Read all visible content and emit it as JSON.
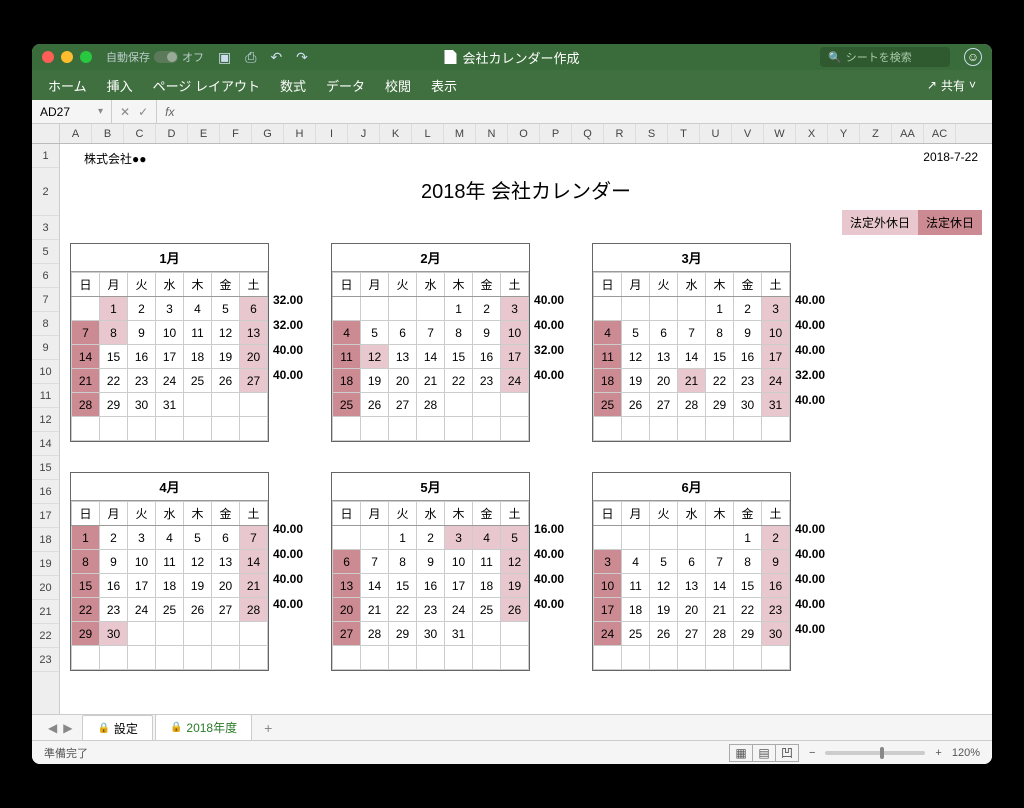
{
  "titlebar": {
    "autosave_label": "自動保存",
    "autosave_state": "オフ",
    "doc_title": "会社カレンダー作成",
    "search_placeholder": "シートを検索"
  },
  "ribbon": {
    "tabs": [
      "ホーム",
      "挿入",
      "ページ レイアウト",
      "数式",
      "データ",
      "校閲",
      "表示"
    ],
    "share_label": "共有"
  },
  "fxbar": {
    "cell_ref": "AD27",
    "fx_label": "fx"
  },
  "col_headers": [
    "A",
    "B",
    "C",
    "D",
    "E",
    "F",
    "G",
    "H",
    "I",
    "J",
    "K",
    "L",
    "M",
    "N",
    "O",
    "P",
    "Q",
    "R",
    "S",
    "T",
    "U",
    "V",
    "W",
    "X",
    "Y",
    "Z",
    "AA",
    "AC"
  ],
  "row_headers": [
    "1",
    "2",
    "3",
    "5",
    "6",
    "7",
    "8",
    "9",
    "10",
    "11",
    "12",
    "14",
    "15",
    "16",
    "17",
    "18",
    "19",
    "20",
    "21",
    "22",
    "23"
  ],
  "sheet": {
    "company": "株式会社●●",
    "date": "2018-7-22",
    "main_title": "2018年 会社カレンダー",
    "legend_light": "法定外休日",
    "legend_dark": "法定休日",
    "dow": [
      "日",
      "月",
      "火",
      "水",
      "木",
      "金",
      "土"
    ],
    "months": [
      {
        "title": "1月",
        "weeks": [
          [
            null,
            [
              1,
              1
            ],
            [
              2,
              0
            ],
            [
              3,
              0
            ],
            [
              4,
              0
            ],
            [
              5,
              0
            ],
            [
              6,
              1
            ]
          ],
          [
            [
              7,
              2
            ],
            [
              8,
              1
            ],
            [
              9,
              0
            ],
            [
              10,
              0
            ],
            [
              11,
              0
            ],
            [
              12,
              0
            ],
            [
              13,
              1
            ]
          ],
          [
            [
              14,
              2
            ],
            [
              15,
              0
            ],
            [
              16,
              0
            ],
            [
              17,
              0
            ],
            [
              18,
              0
            ],
            [
              19,
              0
            ],
            [
              20,
              1
            ]
          ],
          [
            [
              21,
              2
            ],
            [
              22,
              0
            ],
            [
              23,
              0
            ],
            [
              24,
              0
            ],
            [
              25,
              0
            ],
            [
              26,
              0
            ],
            [
              27,
              1
            ]
          ],
          [
            [
              28,
              2
            ],
            [
              29,
              0
            ],
            [
              30,
              0
            ],
            [
              31,
              0
            ],
            null,
            null,
            null
          ],
          [
            null,
            null,
            null,
            null,
            null,
            null,
            null
          ]
        ],
        "hours": [
          "32.00",
          "32.00",
          "40.00",
          "40.00"
        ]
      },
      {
        "title": "2月",
        "weeks": [
          [
            null,
            null,
            null,
            null,
            [
              1,
              0
            ],
            [
              2,
              0
            ],
            [
              3,
              1
            ]
          ],
          [
            [
              4,
              2
            ],
            [
              5,
              0
            ],
            [
              6,
              0
            ],
            [
              7,
              0
            ],
            [
              8,
              0
            ],
            [
              9,
              0
            ],
            [
              10,
              1
            ]
          ],
          [
            [
              11,
              2
            ],
            [
              12,
              1
            ],
            [
              13,
              0
            ],
            [
              14,
              0
            ],
            [
              15,
              0
            ],
            [
              16,
              0
            ],
            [
              17,
              1
            ]
          ],
          [
            [
              18,
              2
            ],
            [
              19,
              0
            ],
            [
              20,
              0
            ],
            [
              21,
              0
            ],
            [
              22,
              0
            ],
            [
              23,
              0
            ],
            [
              24,
              1
            ]
          ],
          [
            [
              25,
              2
            ],
            [
              26,
              0
            ],
            [
              27,
              0
            ],
            [
              28,
              0
            ],
            null,
            null,
            null
          ],
          [
            null,
            null,
            null,
            null,
            null,
            null,
            null
          ]
        ],
        "hours": [
          "40.00",
          "40.00",
          "32.00",
          "40.00"
        ]
      },
      {
        "title": "3月",
        "weeks": [
          [
            null,
            null,
            null,
            null,
            [
              1,
              0
            ],
            [
              2,
              0
            ],
            [
              3,
              1
            ]
          ],
          [
            [
              4,
              2
            ],
            [
              5,
              0
            ],
            [
              6,
              0
            ],
            [
              7,
              0
            ],
            [
              8,
              0
            ],
            [
              9,
              0
            ],
            [
              10,
              1
            ]
          ],
          [
            [
              11,
              2
            ],
            [
              12,
              0
            ],
            [
              13,
              0
            ],
            [
              14,
              0
            ],
            [
              15,
              0
            ],
            [
              16,
              0
            ],
            [
              17,
              1
            ]
          ],
          [
            [
              18,
              2
            ],
            [
              19,
              0
            ],
            [
              20,
              0
            ],
            [
              21,
              1
            ],
            [
              22,
              0
            ],
            [
              23,
              0
            ],
            [
              24,
              1
            ]
          ],
          [
            [
              25,
              2
            ],
            [
              26,
              0
            ],
            [
              27,
              0
            ],
            [
              28,
              0
            ],
            [
              29,
              0
            ],
            [
              30,
              0
            ],
            [
              31,
              1
            ]
          ],
          [
            null,
            null,
            null,
            null,
            null,
            null,
            null
          ]
        ],
        "hours": [
          "40.00",
          "40.00",
          "40.00",
          "32.00",
          "40.00"
        ]
      },
      {
        "title": "4月",
        "weeks": [
          [
            [
              1,
              2
            ],
            [
              2,
              0
            ],
            [
              3,
              0
            ],
            [
              4,
              0
            ],
            [
              5,
              0
            ],
            [
              6,
              0
            ],
            [
              7,
              1
            ]
          ],
          [
            [
              8,
              2
            ],
            [
              9,
              0
            ],
            [
              10,
              0
            ],
            [
              11,
              0
            ],
            [
              12,
              0
            ],
            [
              13,
              0
            ],
            [
              14,
              1
            ]
          ],
          [
            [
              15,
              2
            ],
            [
              16,
              0
            ],
            [
              17,
              0
            ],
            [
              18,
              0
            ],
            [
              19,
              0
            ],
            [
              20,
              0
            ],
            [
              21,
              1
            ]
          ],
          [
            [
              22,
              2
            ],
            [
              23,
              0
            ],
            [
              24,
              0
            ],
            [
              25,
              0
            ],
            [
              26,
              0
            ],
            [
              27,
              0
            ],
            [
              28,
              1
            ]
          ],
          [
            [
              29,
              2
            ],
            [
              30,
              1
            ],
            null,
            null,
            null,
            null,
            null
          ],
          [
            null,
            null,
            null,
            null,
            null,
            null,
            null
          ]
        ],
        "hours": [
          "40.00",
          "40.00",
          "40.00",
          "40.00"
        ]
      },
      {
        "title": "5月",
        "weeks": [
          [
            null,
            null,
            [
              1,
              0
            ],
            [
              2,
              0
            ],
            [
              3,
              1
            ],
            [
              4,
              1
            ],
            [
              5,
              1
            ]
          ],
          [
            [
              6,
              2
            ],
            [
              7,
              0
            ],
            [
              8,
              0
            ],
            [
              9,
              0
            ],
            [
              10,
              0
            ],
            [
              11,
              0
            ],
            [
              12,
              1
            ]
          ],
          [
            [
              13,
              2
            ],
            [
              14,
              0
            ],
            [
              15,
              0
            ],
            [
              16,
              0
            ],
            [
              17,
              0
            ],
            [
              18,
              0
            ],
            [
              19,
              1
            ]
          ],
          [
            [
              20,
              2
            ],
            [
              21,
              0
            ],
            [
              22,
              0
            ],
            [
              23,
              0
            ],
            [
              24,
              0
            ],
            [
              25,
              0
            ],
            [
              26,
              1
            ]
          ],
          [
            [
              27,
              2
            ],
            [
              28,
              0
            ],
            [
              29,
              0
            ],
            [
              30,
              0
            ],
            [
              31,
              0
            ],
            null,
            null
          ],
          [
            null,
            null,
            null,
            null,
            null,
            null,
            null
          ]
        ],
        "hours": [
          "16.00",
          "40.00",
          "40.00",
          "40.00"
        ]
      },
      {
        "title": "6月",
        "weeks": [
          [
            null,
            null,
            null,
            null,
            null,
            [
              1,
              0
            ],
            [
              2,
              1
            ]
          ],
          [
            [
              3,
              2
            ],
            [
              4,
              0
            ],
            [
              5,
              0
            ],
            [
              6,
              0
            ],
            [
              7,
              0
            ],
            [
              8,
              0
            ],
            [
              9,
              1
            ]
          ],
          [
            [
              10,
              2
            ],
            [
              11,
              0
            ],
            [
              12,
              0
            ],
            [
              13,
              0
            ],
            [
              14,
              0
            ],
            [
              15,
              0
            ],
            [
              16,
              1
            ]
          ],
          [
            [
              17,
              2
            ],
            [
              18,
              0
            ],
            [
              19,
              0
            ],
            [
              20,
              0
            ],
            [
              21,
              0
            ],
            [
              22,
              0
            ],
            [
              23,
              1
            ]
          ],
          [
            [
              24,
              2
            ],
            [
              25,
              0
            ],
            [
              26,
              0
            ],
            [
              27,
              0
            ],
            [
              28,
              0
            ],
            [
              29,
              0
            ],
            [
              30,
              1
            ]
          ],
          [
            null,
            null,
            null,
            null,
            null,
            null,
            null
          ]
        ],
        "hours": [
          "40.00",
          "40.00",
          "40.00",
          "40.00",
          "40.00"
        ]
      }
    ]
  },
  "tabs": {
    "sheet1": "設定",
    "sheet2": "2018年度"
  },
  "status": {
    "ready": "準備完了",
    "zoom": "120%"
  }
}
